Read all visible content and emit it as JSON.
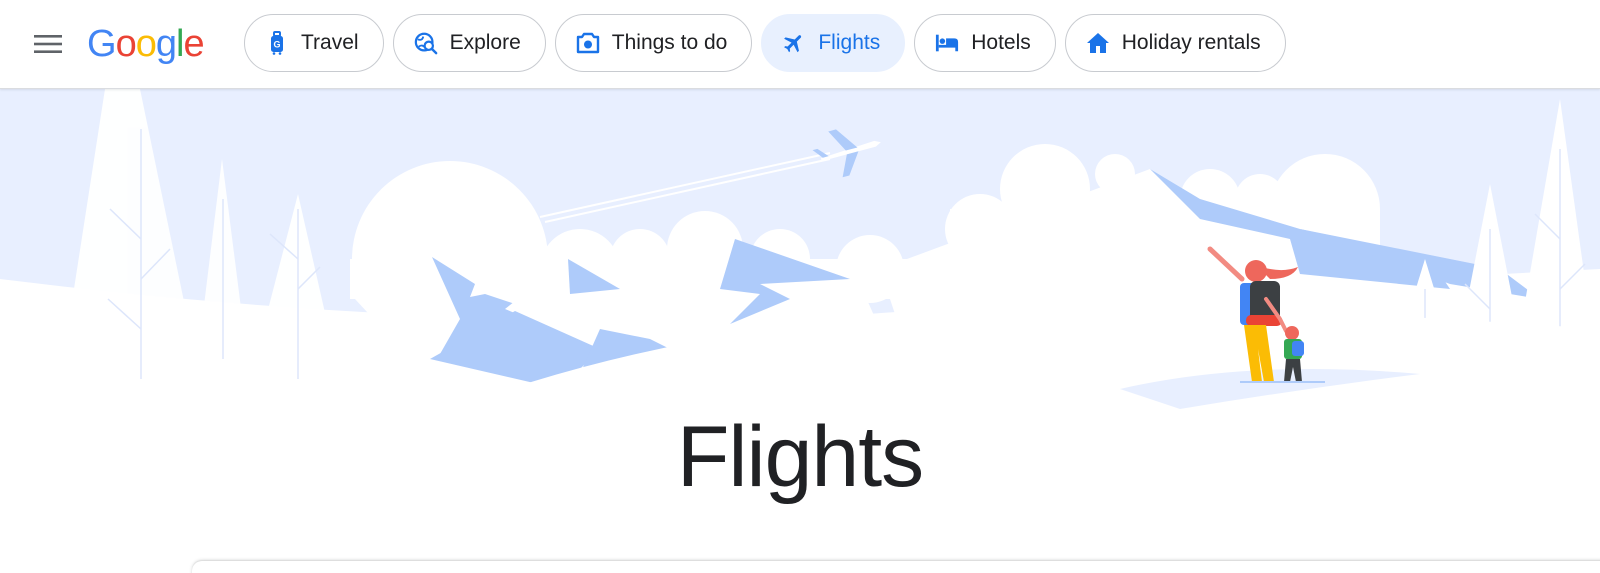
{
  "header": {
    "logo_letters": [
      {
        "ch": "G",
        "color": "#4285F4"
      },
      {
        "ch": "o",
        "color": "#EA4335"
      },
      {
        "ch": "o",
        "color": "#FBBC05"
      },
      {
        "ch": "g",
        "color": "#4285F4"
      },
      {
        "ch": "l",
        "color": "#34A853"
      },
      {
        "ch": "e",
        "color": "#EA4335"
      }
    ],
    "menu_icon": "hamburger-menu-icon",
    "nav": [
      {
        "label": "Travel",
        "icon": "luggage-icon",
        "active": false
      },
      {
        "label": "Explore",
        "icon": "globe-search-icon",
        "active": false
      },
      {
        "label": "Things to do",
        "icon": "camera-icon",
        "active": false
      },
      {
        "label": "Flights",
        "icon": "airplane-icon",
        "active": true
      },
      {
        "label": "Hotels",
        "icon": "bed-icon",
        "active": false
      },
      {
        "label": "Holiday rentals",
        "icon": "house-icon",
        "active": false
      }
    ]
  },
  "main": {
    "title": "Flights"
  },
  "colors": {
    "accent": "#1a73e8",
    "active_chip_bg": "#e8f0fe",
    "sky": "#e8efff",
    "mountain": "#aecbfa"
  }
}
